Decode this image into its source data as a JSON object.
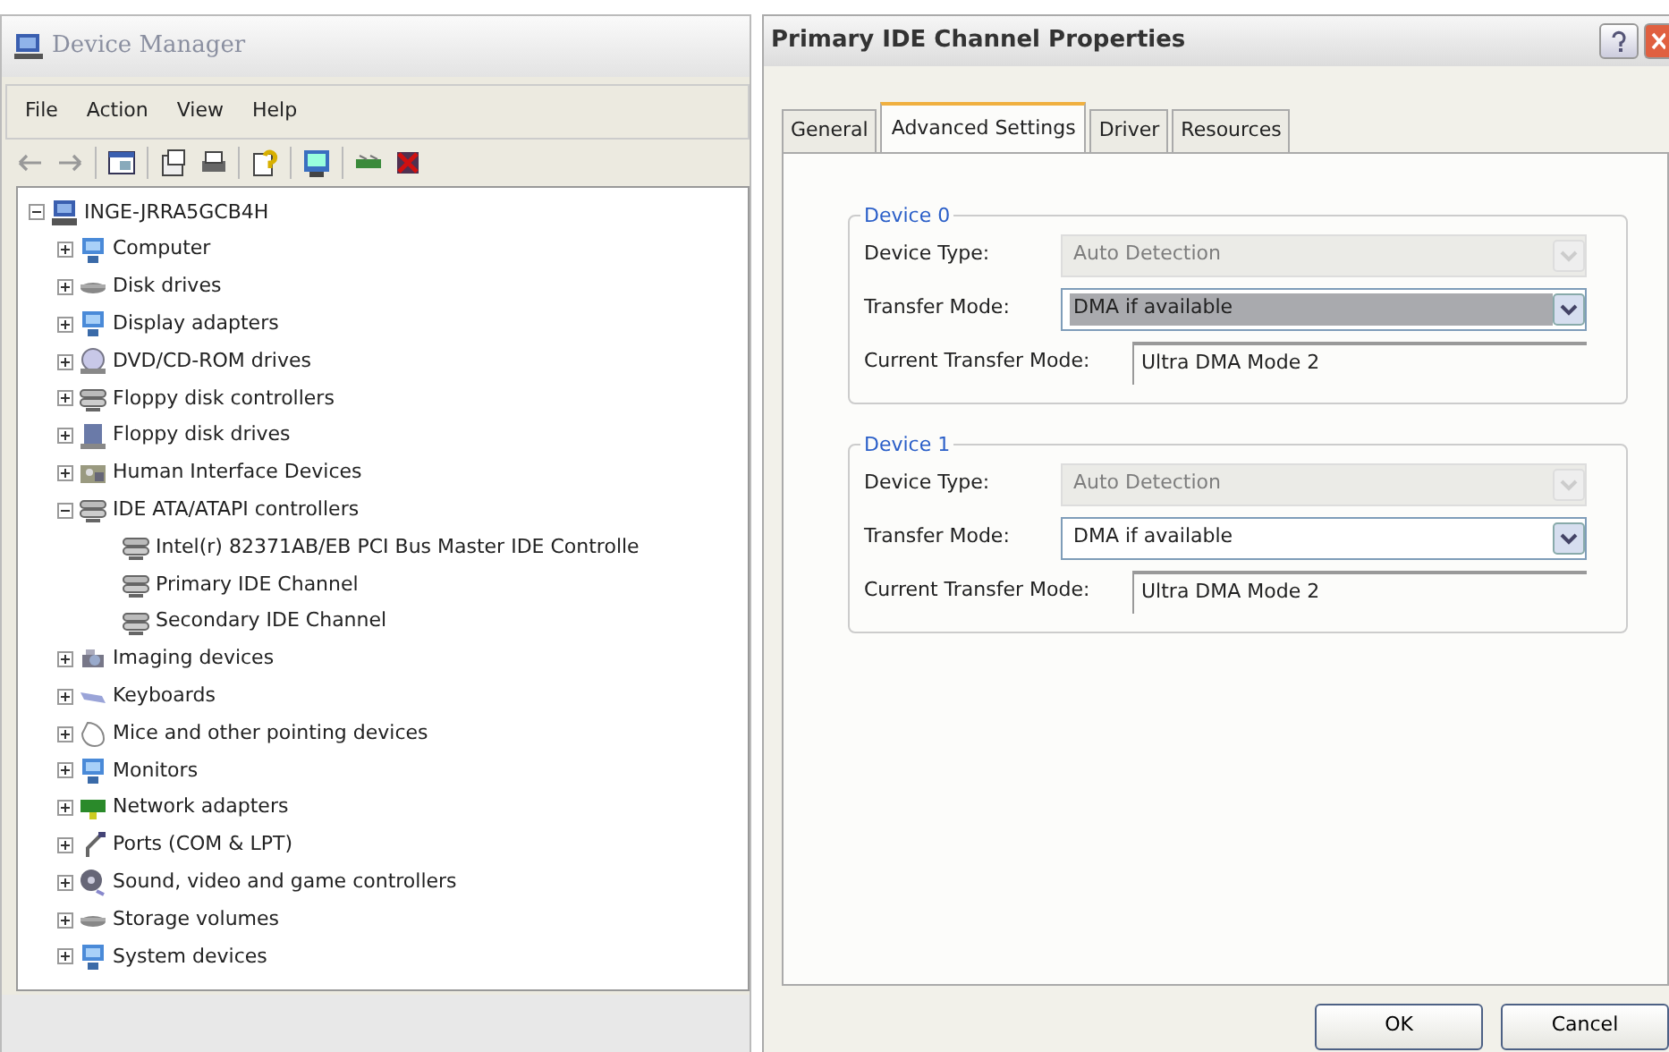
{
  "device_manager": {
    "title": "Device Manager",
    "menu": [
      "File",
      "Action",
      "View",
      "Help"
    ],
    "tree": {
      "label": "INGE-JRRA5GCB4H",
      "expanded": true,
      "children": [
        {
          "label": "Computer",
          "expanded": false
        },
        {
          "label": "Disk drives",
          "expanded": false
        },
        {
          "label": "Display adapters",
          "expanded": false
        },
        {
          "label": "DVD/CD-ROM drives",
          "expanded": false
        },
        {
          "label": "Floppy disk controllers",
          "expanded": false
        },
        {
          "label": "Floppy disk drives",
          "expanded": false
        },
        {
          "label": "Human Interface Devices",
          "expanded": false
        },
        {
          "label": "IDE ATA/ATAPI controllers",
          "expanded": true,
          "children": [
            {
              "label": "Intel(r) 82371AB/EB PCI Bus Master IDE Controlle"
            },
            {
              "label": "Primary IDE Channel"
            },
            {
              "label": "Secondary IDE Channel"
            }
          ]
        },
        {
          "label": "Imaging devices",
          "expanded": false
        },
        {
          "label": "Keyboards",
          "expanded": false
        },
        {
          "label": "Mice and other pointing devices",
          "expanded": false
        },
        {
          "label": "Monitors",
          "expanded": false
        },
        {
          "label": "Network adapters",
          "expanded": false
        },
        {
          "label": "Ports (COM & LPT)",
          "expanded": false
        },
        {
          "label": "Sound, video and game controllers",
          "expanded": false
        },
        {
          "label": "Storage volumes",
          "expanded": false
        },
        {
          "label": "System devices",
          "expanded": false
        }
      ]
    }
  },
  "dialog": {
    "title": "Primary IDE Channel Properties",
    "tabs": [
      {
        "label": "General",
        "selected": false
      },
      {
        "label": "Advanced Settings",
        "selected": true
      },
      {
        "label": "Driver",
        "selected": false
      },
      {
        "label": "Resources",
        "selected": false
      }
    ],
    "groups": [
      {
        "legend": "Device 0",
        "fields": [
          {
            "kind": "select",
            "label": "Device Type:",
            "value": "Auto Detection",
            "disabled": true,
            "focused": false
          },
          {
            "kind": "select",
            "label": "Transfer Mode:",
            "value": "DMA if available",
            "disabled": false,
            "focused": true
          },
          {
            "kind": "readonly",
            "label": "Current Transfer Mode:",
            "value": "Ultra DMA Mode 2"
          }
        ]
      },
      {
        "legend": "Device 1",
        "fields": [
          {
            "kind": "select",
            "label": "Device Type:",
            "value": "Auto Detection",
            "disabled": true,
            "focused": false
          },
          {
            "kind": "select",
            "label": "Transfer Mode:",
            "value": "DMA if available",
            "disabled": false,
            "focused": false
          },
          {
            "kind": "readonly",
            "label": "Current Transfer Mode:",
            "value": "Ultra DMA Mode 2"
          }
        ]
      }
    ],
    "buttons": [
      "OK",
      "Cancel"
    ]
  }
}
